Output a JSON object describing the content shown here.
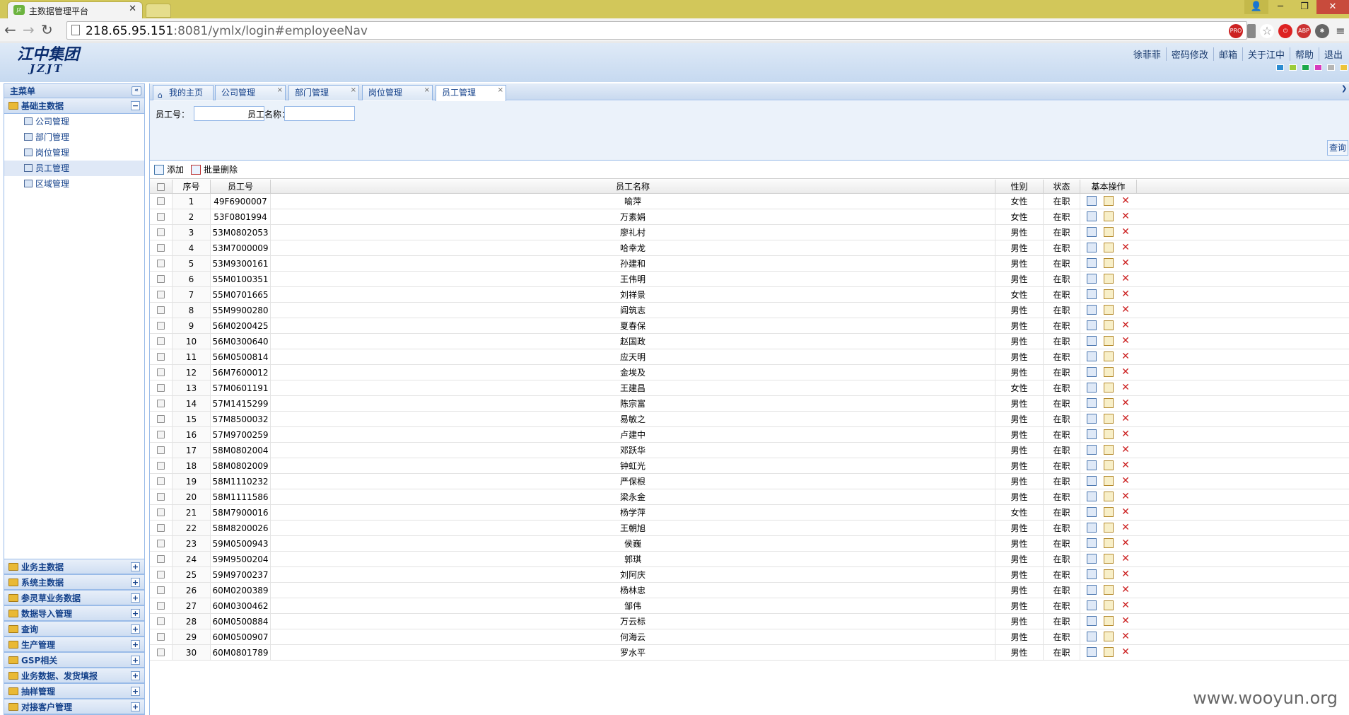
{
  "browser": {
    "tab_title": "主数据管理平台",
    "tab_favicon": "JZ",
    "url_host": "218.65.95.151",
    "url_rest": ":8081/ymlx/login#employeeNav",
    "ext_badges": [
      "PRO",
      "ABP"
    ]
  },
  "header": {
    "logo_main": "江中集团",
    "logo_sub": "JZJT",
    "user_name": "徐菲菲",
    "links": [
      "密码修改",
      "邮箱",
      "关于江中",
      "帮助",
      "退出"
    ],
    "theme_colors": [
      "#2a8bd1",
      "#9ccc3a",
      "#1aa84a",
      "#d63bbd",
      "#b5b5b5",
      "#ecc43a"
    ]
  },
  "sidebar": {
    "title": "主菜单",
    "open_group": "基础主数据",
    "tree": [
      "公司管理",
      "部门管理",
      "岗位管理",
      "员工管理",
      "区域管理"
    ],
    "selected_index": 3,
    "groups": [
      "业务主数据",
      "系统主数据",
      "参灵草业务数据",
      "数据导入管理",
      "查询",
      "生产管理",
      "GSP相关",
      "业务数据、发货填报",
      "抽样管理",
      "对接客户管理"
    ]
  },
  "page_tabs": [
    "我的主页",
    "公司管理",
    "部门管理",
    "岗位管理",
    "员工管理"
  ],
  "search": {
    "employee_no_label": "员工号：",
    "employee_name_label": "员工名称：",
    "employee_no_value": "",
    "employee_name_value": "",
    "button": "查询"
  },
  "toolbar": {
    "add": "添加",
    "batch_delete": "批量删除"
  },
  "grid": {
    "headers": {
      "no": "序号",
      "id": "员工号",
      "name": "员工名称",
      "sex": "性别",
      "status": "状态",
      "ops": "基本操作"
    },
    "rows": [
      [
        "1",
        "49F6900007",
        "喻萍",
        "女性",
        "在职"
      ],
      [
        "2",
        "53F0801994",
        "万素娟",
        "女性",
        "在职"
      ],
      [
        "3",
        "53M0802053",
        "廖礼村",
        "男性",
        "在职"
      ],
      [
        "4",
        "53M7000009",
        "哈幸龙",
        "男性",
        "在职"
      ],
      [
        "5",
        "53M9300161",
        "孙建和",
        "男性",
        "在职"
      ],
      [
        "6",
        "55M0100351",
        "王伟明",
        "男性",
        "在职"
      ],
      [
        "7",
        "55M0701665",
        "刘祥景",
        "女性",
        "在职"
      ],
      [
        "8",
        "55M9900280",
        "阎筑志",
        "男性",
        "在职"
      ],
      [
        "9",
        "56M0200425",
        "夏春保",
        "男性",
        "在职"
      ],
      [
        "10",
        "56M0300640",
        "赵国政",
        "男性",
        "在职"
      ],
      [
        "11",
        "56M0500814",
        "应天明",
        "男性",
        "在职"
      ],
      [
        "12",
        "56M7600012",
        "金埃及",
        "男性",
        "在职"
      ],
      [
        "13",
        "57M0601191",
        "王建昌",
        "女性",
        "在职"
      ],
      [
        "14",
        "57M1415299",
        "陈宗富",
        "男性",
        "在职"
      ],
      [
        "15",
        "57M8500032",
        "易敏之",
        "男性",
        "在职"
      ],
      [
        "16",
        "57M9700259",
        "卢建中",
        "男性",
        "在职"
      ],
      [
        "17",
        "58M0802004",
        "邓跃华",
        "男性",
        "在职"
      ],
      [
        "18",
        "58M0802009",
        "钟虹光",
        "男性",
        "在职"
      ],
      [
        "19",
        "58M1110232",
        "严保根",
        "男性",
        "在职"
      ],
      [
        "20",
        "58M1111586",
        "梁永金",
        "男性",
        "在职"
      ],
      [
        "21",
        "58M7900016",
        "杨学萍",
        "女性",
        "在职"
      ],
      [
        "22",
        "58M8200026",
        "王朝旭",
        "男性",
        "在职"
      ],
      [
        "23",
        "59M0500943",
        "侯巍",
        "男性",
        "在职"
      ],
      [
        "24",
        "59M9500204",
        "郭琪",
        "男性",
        "在职"
      ],
      [
        "25",
        "59M9700237",
        "刘阿庆",
        "男性",
        "在职"
      ],
      [
        "26",
        "60M0200389",
        "杨林忠",
        "男性",
        "在职"
      ],
      [
        "27",
        "60M0300462",
        "邹伟",
        "男性",
        "在职"
      ],
      [
        "28",
        "60M0500884",
        "万云标",
        "男性",
        "在职"
      ],
      [
        "29",
        "60M0500907",
        "何海云",
        "男性",
        "在职"
      ],
      [
        "30",
        "60M0801789",
        "罗水平",
        "男性",
        "在职"
      ]
    ]
  },
  "watermark": "www.wooyun.org"
}
